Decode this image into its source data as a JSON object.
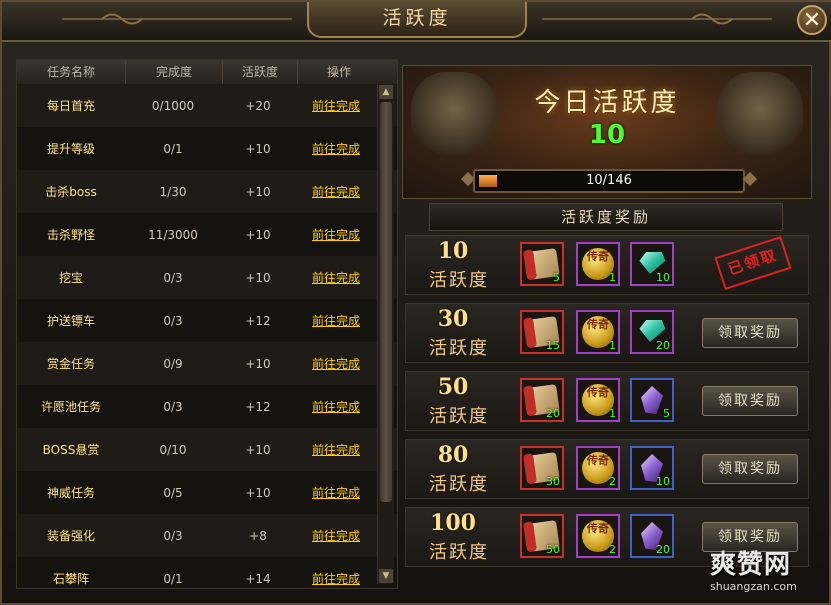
{
  "window": {
    "title": "活跃度"
  },
  "table": {
    "headers": [
      "任务名称",
      "完成度",
      "活跃度",
      "操作"
    ],
    "rows": [
      {
        "name": "每日首充",
        "progress": "0/1000",
        "points": "+20",
        "action": "前往完成"
      },
      {
        "name": "提升等级",
        "progress": "0/1",
        "points": "+10",
        "action": "前往完成"
      },
      {
        "name": "击杀boss",
        "progress": "1/30",
        "points": "+10",
        "action": "前往完成"
      },
      {
        "name": "击杀野怪",
        "progress": "11/3000",
        "points": "+10",
        "action": "前往完成"
      },
      {
        "name": "挖宝",
        "progress": "0/3",
        "points": "+10",
        "action": "前往完成"
      },
      {
        "name": "护送镖车",
        "progress": "0/3",
        "points": "+12",
        "action": "前往完成"
      },
      {
        "name": "赏金任务",
        "progress": "0/9",
        "points": "+10",
        "action": "前往完成"
      },
      {
        "name": "许愿池任务",
        "progress": "0/3",
        "points": "+12",
        "action": "前往完成"
      },
      {
        "name": "BOSS悬赏",
        "progress": "0/10",
        "points": "+10",
        "action": "前往完成"
      },
      {
        "name": "神威任务",
        "progress": "0/5",
        "points": "+10",
        "action": "前往完成"
      },
      {
        "name": "装备强化",
        "progress": "0/3",
        "points": "+8",
        "action": "前往完成"
      },
      {
        "name": "石攀阵",
        "progress": "0/1",
        "points": "+14",
        "action": "前往完成"
      }
    ]
  },
  "today": {
    "title": "今日活跃度",
    "value": "10",
    "progress_text": "10/146",
    "progress_fraction": 0.0685
  },
  "rewards": {
    "title": "活跃度奖励",
    "unit": "活跃度",
    "claim_label": "领取奖励",
    "claimed_label": "已领取",
    "coin_text": "传奇",
    "tiers": [
      {
        "points": "10",
        "status": "claimed",
        "items": [
          {
            "icon": "scroll-icon",
            "count": "5",
            "border": "red"
          },
          {
            "icon": "gold-coin-icon",
            "count": "1",
            "border": "violet"
          },
          {
            "icon": "green-gem-icon",
            "count": "10",
            "border": "violet"
          }
        ]
      },
      {
        "points": "30",
        "status": "claimable",
        "items": [
          {
            "icon": "scroll-icon",
            "count": "15",
            "border": "red"
          },
          {
            "icon": "gold-coin-icon",
            "count": "1",
            "border": "violet"
          },
          {
            "icon": "green-gem-icon",
            "count": "20",
            "border": "violet"
          }
        ]
      },
      {
        "points": "50",
        "status": "claimable",
        "items": [
          {
            "icon": "scroll-icon",
            "count": "20",
            "border": "red"
          },
          {
            "icon": "gold-coin-icon",
            "count": "1",
            "border": "violet"
          },
          {
            "icon": "purple-gem-icon",
            "count": "5",
            "border": "blue"
          }
        ]
      },
      {
        "points": "80",
        "status": "claimable",
        "items": [
          {
            "icon": "scroll-icon",
            "count": "30",
            "border": "red"
          },
          {
            "icon": "gold-coin-icon",
            "count": "2",
            "border": "violet"
          },
          {
            "icon": "purple-gem-icon",
            "count": "10",
            "border": "blue"
          }
        ]
      },
      {
        "points": "100",
        "status": "claimable",
        "items": [
          {
            "icon": "scroll-icon",
            "count": "50",
            "border": "red"
          },
          {
            "icon": "gold-coin-icon",
            "count": "2",
            "border": "violet"
          },
          {
            "icon": "purple-gem-icon",
            "count": "20",
            "border": "blue"
          }
        ]
      }
    ]
  },
  "watermark": {
    "main": "爽赞网",
    "sub": "shuangzan.com"
  },
  "colors": {
    "accent_gold": "#ffd000",
    "progress_green": "#4cff2c",
    "claimed_red": "#e02020"
  }
}
